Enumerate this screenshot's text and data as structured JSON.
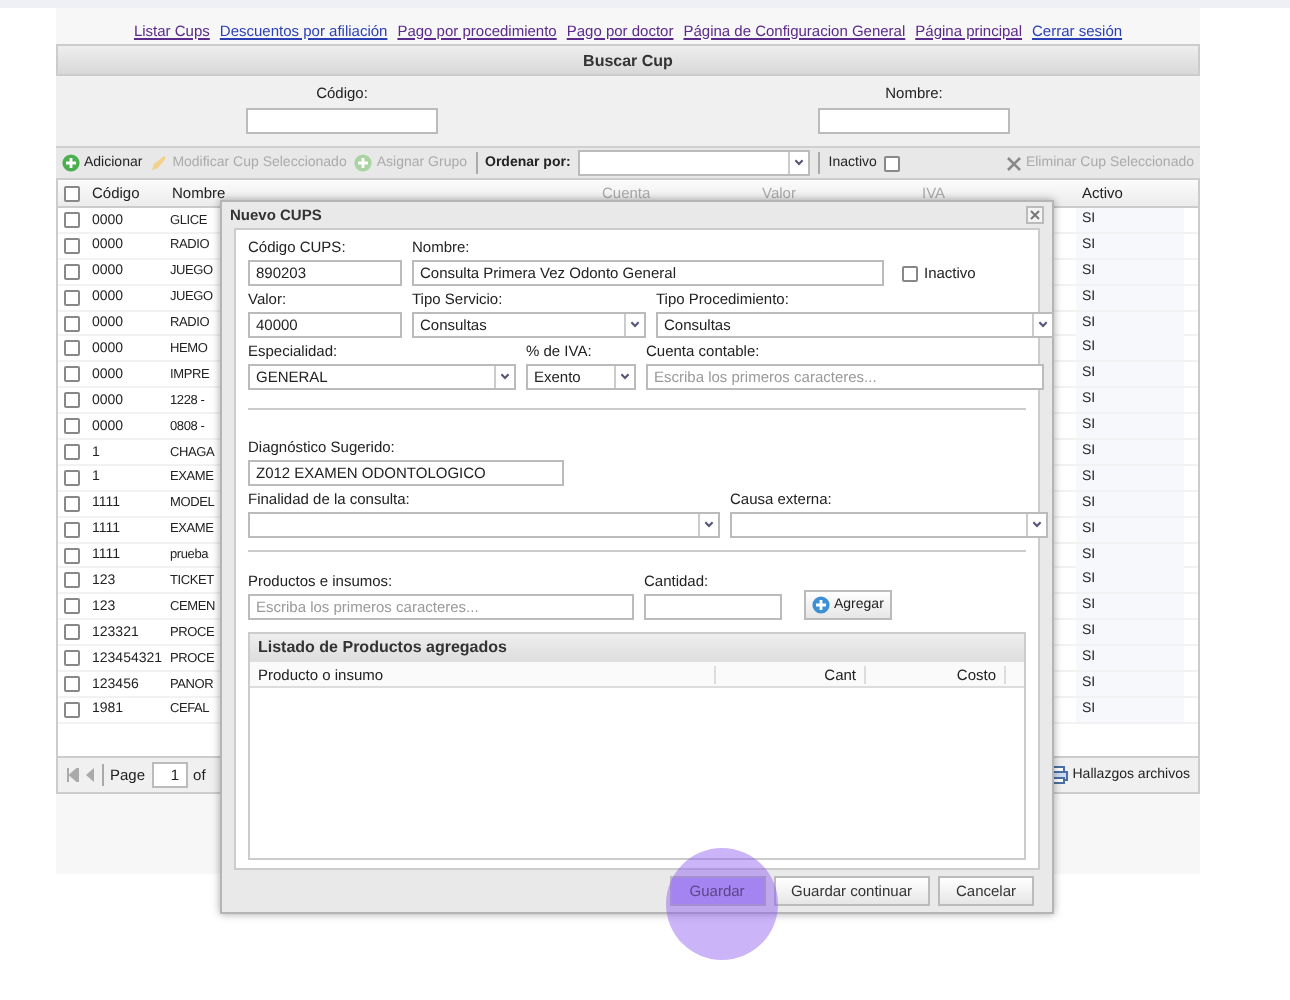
{
  "nav_links": [
    "Listar Cups",
    "Descuentos por afiliación",
    "Pago por procedimiento",
    "Pago por doctor",
    "Página de Configuracion General",
    "Página principal",
    "Cerrar sesión"
  ],
  "search_panel": {
    "title": "Buscar Cup",
    "fields": [
      {
        "label": "Código:"
      },
      {
        "label": "Nombre:"
      }
    ]
  },
  "toolbar": {
    "buttons": [
      {
        "kind": "add",
        "label": "Adicionar",
        "disabled": false
      },
      {
        "kind": "edit",
        "label": "Modificar Cup Seleccionado",
        "disabled": true
      },
      {
        "kind": "add",
        "label": "Asignar Grupo",
        "disabled": true
      }
    ],
    "sort_label": "Ordenar por:",
    "inactive": {
      "label": "Inactivo",
      "checked": false
    },
    "delete": {
      "label": "Eliminar Cup Seleccionado",
      "disabled": true
    }
  },
  "grid": {
    "all_checked": false,
    "columns": [
      "Código",
      "Nombre",
      "Cuenta",
      "Valor",
      "IVA",
      "Activo"
    ],
    "rows": [
      {
        "code": "0000",
        "name": "GLICE",
        "active": "SI",
        "checked": false
      },
      {
        "code": "0000",
        "name": "RADIO",
        "active": "SI",
        "checked": false
      },
      {
        "code": "0000",
        "name": "JUEGO",
        "active": "SI",
        "checked": false
      },
      {
        "code": "0000",
        "name": "JUEGO",
        "active": "SI",
        "checked": false
      },
      {
        "code": "0000",
        "name": "RADIO",
        "active": "SI",
        "checked": false
      },
      {
        "code": "0000",
        "name": "HEMO",
        "active": "SI",
        "checked": false
      },
      {
        "code": "0000",
        "name": "IMPRE",
        "active": "SI",
        "checked": false
      },
      {
        "code": "0000",
        "name": "1228 -",
        "active": "SI",
        "checked": false
      },
      {
        "code": "0000",
        "name": "0808 -",
        "active": "SI",
        "checked": false
      },
      {
        "code": "1",
        "name": "CHAGA",
        "active": "SI",
        "checked": false
      },
      {
        "code": "1",
        "name": "EXAME",
        "active": "SI",
        "checked": false
      },
      {
        "code": "1111",
        "name": "MODEL",
        "active": "SI",
        "checked": false
      },
      {
        "code": "1111",
        "name": "EXAME",
        "active": "SI",
        "checked": false
      },
      {
        "code": "1111",
        "name": "prueba",
        "active": "SI",
        "checked": false
      },
      {
        "code": "123",
        "name": "TICKET",
        "active": "SI",
        "checked": false
      },
      {
        "code": "123",
        "name": "CEMEN",
        "active": "SI",
        "checked": false
      },
      {
        "code": "123321",
        "name": "PROCE",
        "active": "SI",
        "checked": false
      },
      {
        "code": "123454321",
        "name": "PROCE",
        "active": "SI",
        "checked": false
      },
      {
        "code": "123456",
        "name": "PANOR",
        "active": "SI",
        "checked": false
      },
      {
        "code": "1981",
        "name": "CEFAL",
        "active": "SI",
        "checked": false
      }
    ]
  },
  "pager": {
    "page_label": "Page",
    "page": "1",
    "of_label": "of"
  },
  "export_label": "Hallazgos archivos",
  "dialog": {
    "title": "Nuevo CUPS",
    "codigo": {
      "label": "Código CUPS:",
      "value": "890203"
    },
    "nombre": {
      "label": "Nombre:",
      "value": "Consulta Primera Vez Odonto General"
    },
    "inactivo": {
      "label": "Inactivo",
      "checked": false
    },
    "valor": {
      "label": "Valor:",
      "value": "40000"
    },
    "tipo_servicio": {
      "label": "Tipo Servicio:",
      "value": "Consultas"
    },
    "tipo_procedimiento": {
      "label": "Tipo Procedimiento:",
      "value": "Consultas"
    },
    "especialidad": {
      "label": "Especialidad:",
      "value": "GENERAL"
    },
    "iva": {
      "label": "% de IVA:",
      "value": "Exento"
    },
    "cuenta_contable": {
      "label": "Cuenta contable:",
      "placeholder": "Escriba los primeros caracteres..."
    },
    "diagnostico": {
      "label": "Diagnóstico Sugerido:",
      "value": "Z012 EXAMEN ODONTOLOGICO"
    },
    "finalidad": {
      "label": "Finalidad de la consulta:"
    },
    "causa_externa": {
      "label": "Causa externa:"
    },
    "productos": {
      "label": "Productos e insumos:",
      "placeholder": "Escriba los primeros caracteres..."
    },
    "cantidad": {
      "label": "Cantidad:"
    },
    "add_button": "Agregar",
    "list": {
      "title": "Listado de Productos agregados",
      "columns": [
        "Producto o insumo",
        "Cant",
        "Costo"
      ]
    },
    "buttons": [
      {
        "label": "Guardar",
        "focused": true
      },
      {
        "label": "Guardar continuar",
        "focused": false
      },
      {
        "label": "Cancelar",
        "focused": false
      }
    ]
  }
}
